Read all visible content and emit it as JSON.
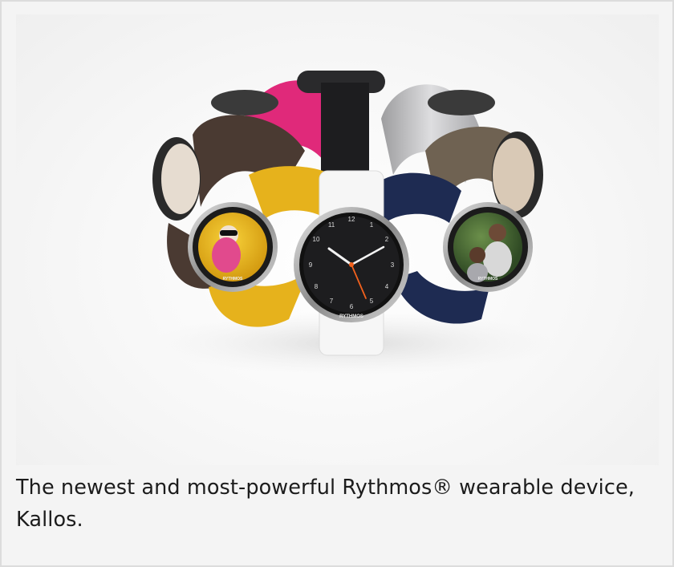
{
  "product_photo": {
    "brand_on_dial": "RYTHMOS",
    "dial_numbers": [
      "12",
      "1",
      "2",
      "3",
      "4",
      "5",
      "6",
      "7",
      "8",
      "9",
      "10",
      "11"
    ],
    "strap_colors": {
      "pink": "#e0297a",
      "yellow": "#e6b21c",
      "white": "#f6f6f6",
      "navy": "#1e2b52",
      "brown": "#4a3a32",
      "black": "#1d1d1f",
      "mesh": "#b9b9bb",
      "olive": "#6f6252"
    },
    "accent_hand_color": "#f2611d"
  },
  "caption": {
    "text": "The newest and most-powerful Rythmos® wearable device, Kallos."
  }
}
